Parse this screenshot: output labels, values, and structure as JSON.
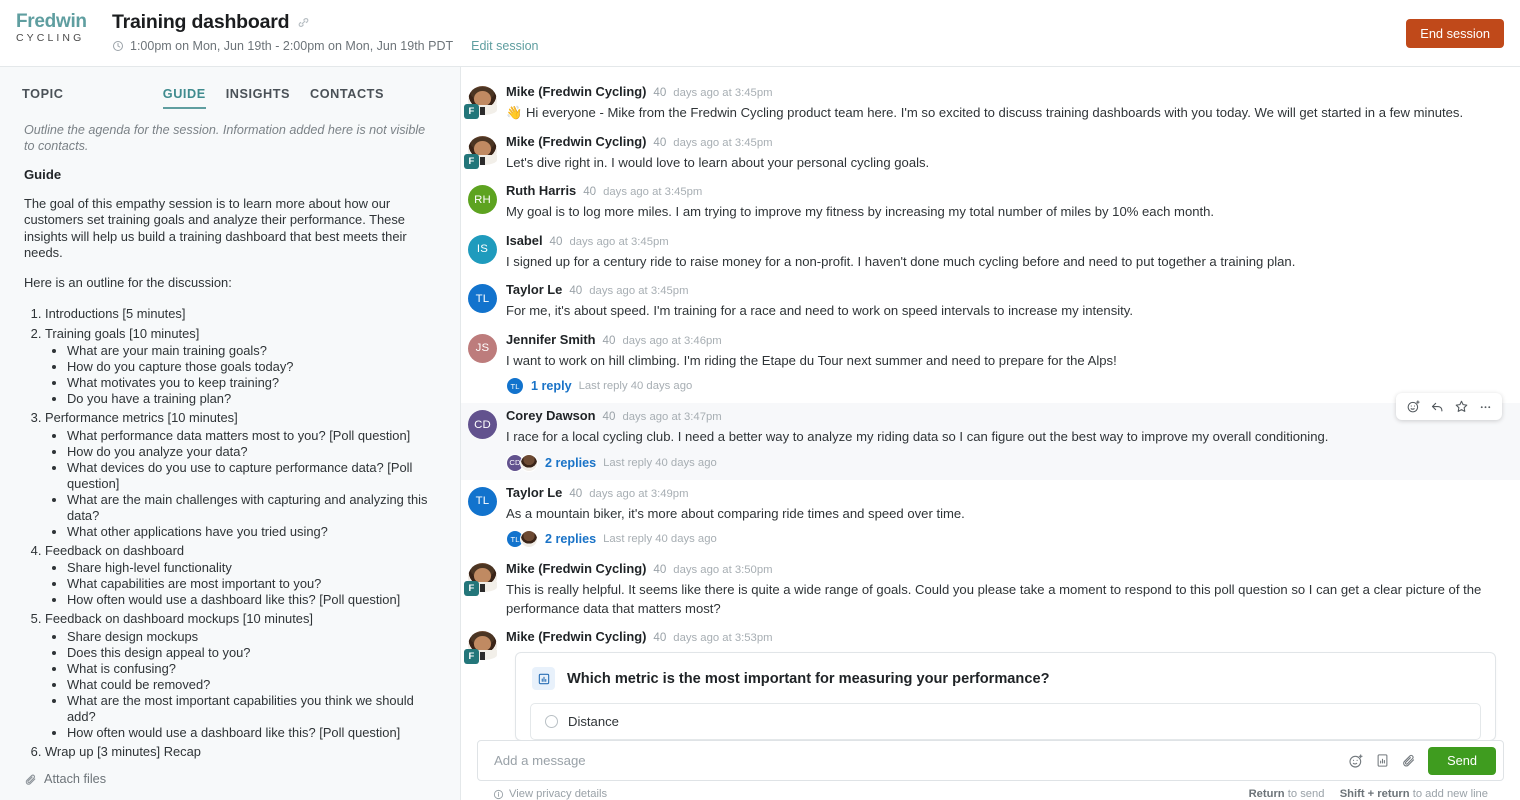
{
  "brand": {
    "line1": "Fredwin",
    "line2": "CYCLING",
    "accent": "#5f9ea0"
  },
  "header": {
    "title": "Training dashboard",
    "link_icon": "link-icon",
    "clock_icon": "clock-icon",
    "schedule": "1:00pm on Mon, Jun 19th - 2:00pm on Mon, Jun 19th PDT",
    "edit_session": "Edit session",
    "end_session": "End session",
    "end_session_color": "#c0491a"
  },
  "sidebar": {
    "topic_label": "TOPIC",
    "tabs": [
      {
        "label": "GUIDE",
        "active": true
      },
      {
        "label": "INSIGHTS",
        "active": false
      },
      {
        "label": "CONTACTS",
        "active": false
      }
    ],
    "hint": "Outline the agenda for the session. Information added here is not visible to contacts.",
    "guide_heading": "Guide",
    "paragraphs": [
      "The goal of this empathy session is to learn more about how our customers set training goals and analyze their performance. These insights will help us build a training dashboard that best meets their needs.",
      "Here is an outline for the discussion:"
    ],
    "outline": [
      {
        "label": "Introductions [5 minutes]",
        "children": []
      },
      {
        "label": "Training goals [10 minutes]",
        "children": [
          "What are your main training goals?",
          "How do you capture those goals today?",
          "What motivates you to keep training?",
          "Do you have a training plan?"
        ]
      },
      {
        "label": "Performance metrics [10 minutes]",
        "children": [
          "What performance data matters most to you? [Poll question]",
          "How do you analyze your data?",
          "What devices do you use to capture performance data? [Poll question]",
          "What are the main challenges with capturing and analyzing this data?",
          "What other applications have you tried using?"
        ]
      },
      {
        "label": "Feedback on dashboard",
        "children": [
          "Share high-level functionality",
          "What capabilities are most important to you?",
          "How often would use a dashboard like this? [Poll question]"
        ]
      },
      {
        "label": "Feedback on dashboard mockups [10 minutes]",
        "children": [
          "Share design mockups",
          "Does this design appeal to you?",
          "What is confusing?",
          "What could be removed?",
          "What are the most important capabilities you think we should add?",
          "How often would use a dashboard like this? [Poll question]"
        ]
      },
      {
        "label": "Wrap up [3 minutes] Recap",
        "children": []
      }
    ],
    "attach_files": "Attach files",
    "attach_icon": "paperclip-icon"
  },
  "chat": {
    "messages": [
      {
        "author": "Mike (Fredwin Cycling)",
        "meta_num": "40",
        "meta": "days ago at 3:45pm",
        "avatar_type": "photo",
        "avatar_badge": "F",
        "avatar_color": "#23767a",
        "initials": "",
        "text": "👋 Hi everyone - Mike from the Fredwin Cycling product team here. I'm so excited to discuss training dashboards with you today. We will get started in a few minutes."
      },
      {
        "author": "Mike (Fredwin Cycling)",
        "meta_num": "40",
        "meta": "days ago at 3:45pm",
        "avatar_type": "photo",
        "avatar_badge": "F",
        "avatar_color": "#23767a",
        "initials": "",
        "text": "Let's dive right in. I would love to learn about your personal cycling goals."
      },
      {
        "author": "Ruth Harris",
        "meta_num": "40",
        "meta": "days ago at 3:45pm",
        "avatar_type": "initials",
        "initials": "RH",
        "avatar_color": "#5da320",
        "text": "My goal is to log more miles. I am trying to improve my fitness by increasing my total number of miles by 10% each month."
      },
      {
        "author": "Isabel",
        "meta_num": "40",
        "meta": "days ago at 3:45pm",
        "avatar_type": "initials",
        "initials": "IS",
        "avatar_color": "#1f9bbd",
        "text": "I signed up for a century ride to raise money for a non-profit. I haven't done much cycling before and need to put together a training plan."
      },
      {
        "author": "Taylor Le",
        "meta_num": "40",
        "meta": "days ago at 3:45pm",
        "avatar_type": "initials",
        "initials": "TL",
        "avatar_color": "#1273cd",
        "text": "For me, it's about speed. I'm training for a race and need to work on speed intervals to increase my intensity."
      },
      {
        "author": "Jennifer Smith",
        "meta_num": "40",
        "meta": "days ago at 3:46pm",
        "avatar_type": "initials",
        "initials": "JS",
        "avatar_color": "#bd7c7c",
        "text": "I want to work on hill climbing. I'm riding the Etape du Tour next summer and need to prepare for the Alps!",
        "thread": {
          "link": "1 reply",
          "meta_num": "40",
          "meta_prefix": "Last reply",
          "meta_suffix": "days ago",
          "avatars": [
            {
              "type": "initials",
              "initials": "TL",
              "color": "#1273cd"
            }
          ]
        }
      },
      {
        "author": "Corey Dawson",
        "meta_num": "40",
        "meta": "days ago at 3:47pm",
        "avatar_type": "initials",
        "initials": "CD",
        "avatar_color": "#62528e",
        "highlight": true,
        "text": "I race for a local cycling club. I need a better way to analyze my riding data so I can figure out the best way to improve my overall conditioning.",
        "thread": {
          "link": "2 replies",
          "meta_num": "40",
          "meta_prefix": "Last reply",
          "meta_suffix": "days ago",
          "avatars": [
            {
              "type": "initials",
              "initials": "CD",
              "color": "#62528e"
            },
            {
              "type": "photo",
              "initials": "",
              "color": "#6d4a33"
            }
          ]
        },
        "hover_actions": [
          {
            "icon": "add-reaction-icon",
            "name": "add-reaction-button"
          },
          {
            "icon": "reply-icon",
            "name": "reply-button"
          },
          {
            "icon": "star-icon",
            "name": "star-button"
          },
          {
            "icon": "more-icon",
            "name": "more-options-button"
          }
        ]
      },
      {
        "author": "Taylor Le",
        "meta_num": "40",
        "meta": "days ago at 3:49pm",
        "avatar_type": "initials",
        "initials": "TL",
        "avatar_color": "#1273cd",
        "text": "As a mountain biker, it's more about comparing ride times and speed over time.",
        "thread": {
          "link": "2 replies",
          "meta_num": "40",
          "meta_prefix": "Last reply",
          "meta_suffix": "days ago",
          "avatars": [
            {
              "type": "initials",
              "initials": "TL",
              "color": "#1273cd"
            },
            {
              "type": "photo",
              "initials": "",
              "color": "#6d4a33"
            }
          ]
        }
      },
      {
        "author": "Mike (Fredwin Cycling)",
        "meta_num": "40",
        "meta": "days ago at 3:50pm",
        "avatar_type": "photo",
        "avatar_badge": "F",
        "avatar_color": "#23767a",
        "initials": "",
        "text": "This is really helpful. It seems like there is quite a wide range of goals. Could you please take a moment to respond to this poll question so I can get a clear picture of the performance data that matters most?"
      },
      {
        "author": "Mike (Fredwin Cycling)",
        "meta_num": "40",
        "meta": "days ago at 3:53pm",
        "avatar_type": "photo",
        "avatar_badge": "F",
        "avatar_color": "#23767a",
        "initials": "",
        "text": "",
        "poll": {
          "icon": "poll-chart-icon",
          "question": "Which metric is the most important for measuring your performance?",
          "options": [
            "Distance"
          ]
        }
      }
    ]
  },
  "composer": {
    "placeholder": "Add a message",
    "value": "",
    "icons": [
      {
        "name": "add-reaction-icon"
      },
      {
        "name": "poll-icon"
      },
      {
        "name": "paperclip-icon"
      }
    ],
    "send_label": "Send",
    "send_color": "#3f9c1f",
    "privacy": "View privacy details",
    "privacy_icon": "info-icon",
    "hint_return": "Return",
    "hint_return_rest": "to send",
    "hint_shift": "Shift + return",
    "hint_shift_rest": "to add new line"
  }
}
